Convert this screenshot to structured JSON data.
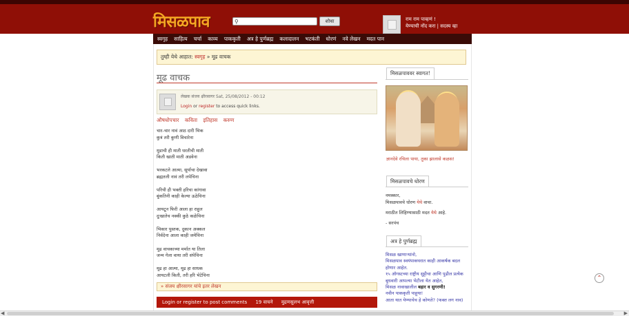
{
  "header": {
    "logo": "मिसळपाव",
    "search_placeholder": "",
    "search_button": "शोधा",
    "greeting": "राम राम पाव्हणं !",
    "user_links": "येण्याची नोंद करा | सदस्य व्हा"
  },
  "nav": [
    "स्वगृह",
    "साहित्य",
    "चर्चा",
    "काव्य",
    "पाककृती",
    "अत्र हे पुर्णब्रह्म",
    "कलादालन",
    "भटकंती",
    "धोरणं",
    "नवे लेखन",
    "मदत पान"
  ],
  "breadcrumb": {
    "prefix": "तुम्ही येथे आहात: ",
    "home": "स्वगृह",
    "sep": " » ",
    "current": "मूढ वाचक"
  },
  "article": {
    "title": "मूढ वाचक",
    "byline": "लेखक संजय क्षीरसागर Sat, 25/08/2012 - 00:12",
    "login_text_1": "Login",
    "login_text_2": " or ",
    "login_text_3": "register",
    "login_text_4": " to access quick links.",
    "tags": [
      "औषधोपचार",
      "कविता",
      "इतिहास",
      "करुण"
    ],
    "stanzas": [
      [
        "चार-चार नावं आठ दारी भिक",
        "कुत्रं तरी कुणी विचारेना"
      ],
      [
        "मुडाची ही माती धरतीची माती",
        "किती खाती माती अडवेना"
      ],
      [
        "भरकटले आत्मा, सूर्याचा देखावा",
        "ब्रह्मतली नावं तरी लपेचिना"
      ],
      [
        "परिची ही भक्ती हरिचा कांगावा",
        "बुंकतिनी काही केल्या ऊठेचिना"
      ],
      [
        "आयटून फिरी आला हा राहुल",
        "दुःखातेच नक्की कुठे कळेचिना"
      ],
      [
        "भिकार पुस्तक, दुकान अक्कल",
        "निर्वदेना आला काही जमेचिना"
      ],
      [
        "मूढ वाचकाच्या मर्मात या तिला",
        "जन्म गेला वाया तरी संपेचिना"
      ],
      [
        "मूढ हा आत्मा, मूढ हा साधक",
        "आयटली किती, तरी हरि भेटेचिना"
      ]
    ],
    "author_more": "» संजय क्षीरसागर यांचे इतर लेखन",
    "bottom_bar": [
      "Login or register to post comments",
      "19 वाचने",
      "मुद्रणसुलभ आवृत्ती"
    ]
  },
  "sidebar": {
    "welcome_head": "मिसळपाववर स्वागत!",
    "image_caption": "ज्ञानदेवे रचिला पाया, तुका झालासे कळस!",
    "policy_head": "मिसळपावचे धोरण",
    "policy_line1": "नमस्कार,",
    "policy_line2_a": "मिसळपावचे धोरण ",
    "policy_line2_b": "येथे",
    "policy_line2_c": " वाचा.",
    "policy_line3_a": "मराठीत लिहिण्यासाठी मदत ",
    "policy_line3_b": "येथे",
    "policy_line3_c": " आहे.",
    "policy_sign": "- सरपंच",
    "food_head": "अत्र हे पुर्णब्रह्म",
    "food_links": [
      "मिसळ खाणाऱ्यांनो,",
      "मिसळपाव स्वयंपाकघरात काही आकर्षक बदल होणार आहेत.",
      "१५ ऑगस्टच्या राष्ट्रीय सुट्टीचा आणि पुढील प्रत्येक बुधवारी आपल्या भेटीला येत आहेत,",
      "मिसळ नावाखालील ",
      "नवीन पाककृती पाहूया!",
      "आता यात येण्याचेच हे कोणते? (फक्त लग नाव)"
    ],
    "food_bold": "बहार व सुगरणी!"
  },
  "scroll_up_icon": "chevron-up"
}
